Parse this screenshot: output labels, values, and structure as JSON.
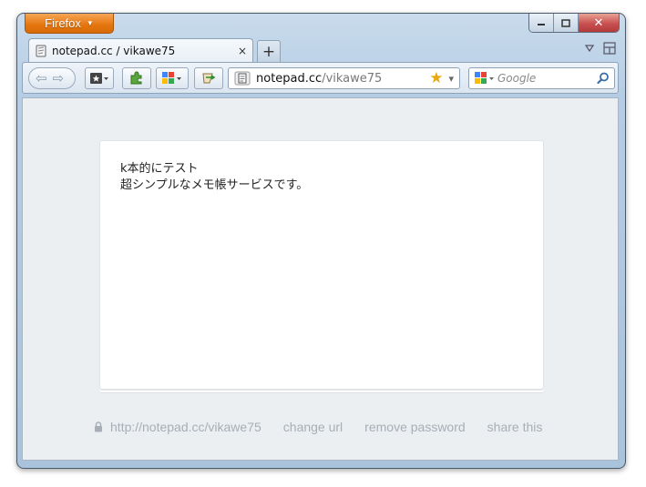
{
  "window": {
    "app_button_label": "Firefox",
    "controls": {
      "minimize": "−",
      "maximize": "□",
      "close": "✕"
    }
  },
  "tab": {
    "title": "notepad.cc / vikawe75",
    "close_glyph": "×",
    "new_tab_glyph": "+"
  },
  "navbar": {
    "url_host": "notepad.cc",
    "url_path": "/vikawe75",
    "search_placeholder": "Google",
    "bookmark_star": "★",
    "dropdown_glyph": "▾"
  },
  "note": {
    "lines": [
      "k本的にテスト",
      "超シンプルなメモ帳サービスです。"
    ]
  },
  "footer": {
    "url": "http://notepad.cc/vikawe75",
    "change_url": "change url",
    "remove_password": "remove password",
    "share_this": "share this"
  },
  "colors": {
    "firefox_orange": "#e4750e",
    "close_red": "#c75050",
    "footer_text": "#a7aeb6",
    "content_bg": "#eceff2"
  }
}
